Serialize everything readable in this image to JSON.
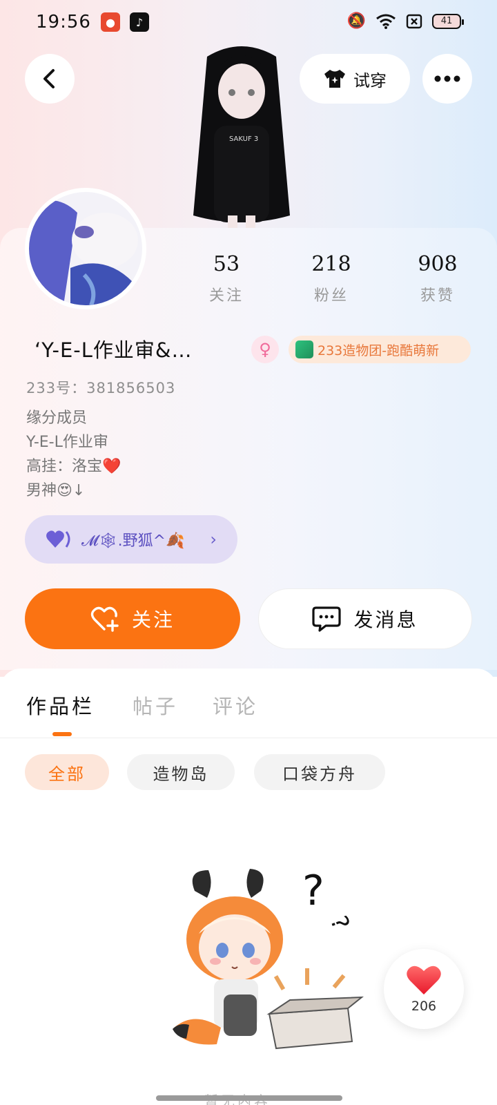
{
  "status_bar": {
    "time": "19:56",
    "battery": "41",
    "icons": [
      "mute-icon",
      "wifi-icon",
      "sim-off-icon",
      "battery-icon"
    ]
  },
  "header": {
    "back_icon": "chevron-left-icon",
    "tryon_label": "试穿",
    "more_icon": "more-dots-icon"
  },
  "profile": {
    "stats": [
      {
        "value": "53",
        "label": "关注"
      },
      {
        "value": "218",
        "label": "粉丝"
      },
      {
        "value": "908",
        "label": "获赞"
      }
    ],
    "username": "‘Y-E-L作业审&…",
    "team_badge": "233造物团-跑酷萌新",
    "uid": "233号：381856503",
    "bio": [
      "缘分成员",
      "Y-E-L作业审",
      "高挂：洛宝❤️",
      "男神😍↓"
    ],
    "relation": "𝓜🕸.野狐^🍂"
  },
  "actions": {
    "follow_label": "关注",
    "message_label": "发消息"
  },
  "tabs": [
    {
      "label": "作品栏",
      "active": true
    },
    {
      "label": "帖子",
      "active": false
    },
    {
      "label": "评论",
      "active": false
    }
  ],
  "filters": [
    {
      "label": "全部",
      "active": true
    },
    {
      "label": "造物岛",
      "active": false
    },
    {
      "label": "口袋方舟",
      "active": false
    }
  ],
  "empty_state": {
    "text": "暂无内容"
  },
  "like_fab": {
    "count": "206"
  },
  "colors": {
    "accent": "#fb7312",
    "accent_soft": "#fde6da",
    "relation_bg": "#e2dcf5",
    "gender_pink": "#f06a9a"
  }
}
